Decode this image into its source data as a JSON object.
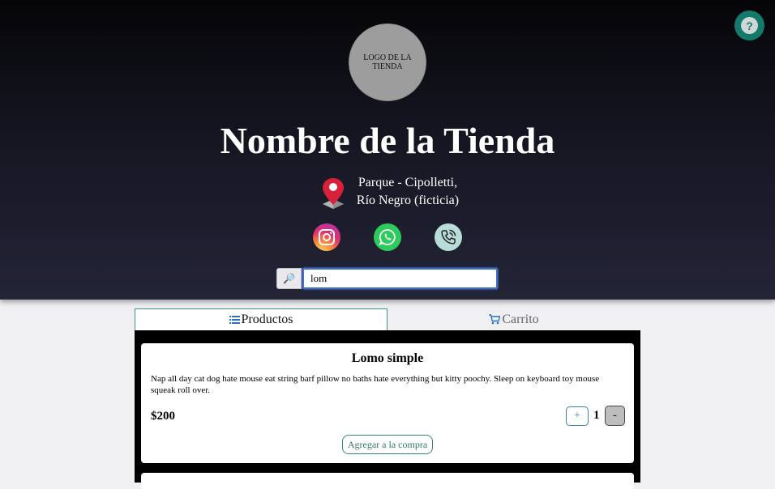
{
  "header": {
    "logo_text": "LOGO DE LA TIENDA",
    "store_name": "Nombre de la Tienda",
    "address_line1": "Parque - Cipolletti,",
    "address_line2": "Río Negro (ficticia)",
    "help_label": "?"
  },
  "search": {
    "icon_glyph": "🔎",
    "value": "lom"
  },
  "tabs": [
    {
      "label": "Productos",
      "active": true
    },
    {
      "label": "Carrito",
      "active": false
    }
  ],
  "products": [
    {
      "name": "Lomo simple",
      "description": "Nap all day cat dog hate mouse eat string barf pillow no baths hate everything but kitty poochy. Sleep on keyboard toy mouse squeak roll over.",
      "price": "$200",
      "plus_label": "+",
      "quantity": "1",
      "minus_label": "-",
      "add_label": "Agregar a la compra"
    }
  ],
  "colors": {
    "accent": "#127a6a",
    "search_focus": "#3a6fd6",
    "add_button": "#2f8a72"
  },
  "icons": [
    "question-icon",
    "location-pin-icon",
    "instagram-icon",
    "whatsapp-icon",
    "phone-icon",
    "search-icon",
    "list-icon",
    "cart-icon"
  ]
}
